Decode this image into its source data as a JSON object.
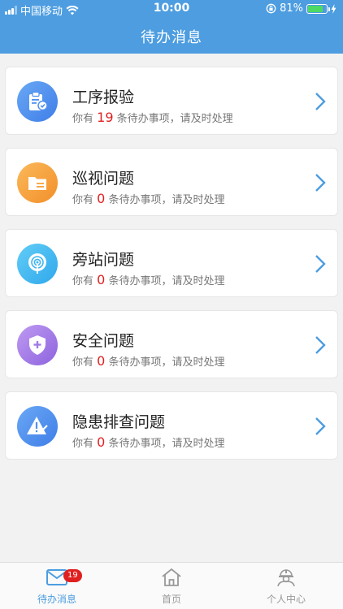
{
  "status_bar": {
    "carrier": "中国移动",
    "time": "10:00",
    "battery": "81%",
    "battery_level": 0.81
  },
  "header": {
    "title": "待办消息"
  },
  "items": [
    {
      "title": "工序报验",
      "prefix": "你有",
      "count": "19",
      "suffix": "条待办事项，请及时处理",
      "icon": "clipboard-icon",
      "color": "#4f8ff0"
    },
    {
      "title": "巡视问题",
      "prefix": "你有",
      "count": "0",
      "suffix": "条待办事项，请及时处理",
      "icon": "folder-icon",
      "color": "#f7a23c"
    },
    {
      "title": "旁站问题",
      "prefix": "你有",
      "count": "0",
      "suffix": "条待办事项，请及时处理",
      "icon": "broadcast-icon",
      "color": "#3fb6f0"
    },
    {
      "title": "安全问题",
      "prefix": "你有",
      "count": "0",
      "suffix": "条待办事项，请及时处理",
      "icon": "shield-icon",
      "color": "#a07be6"
    },
    {
      "title": "隐患排查问题",
      "prefix": "你有",
      "count": "0",
      "suffix": "条待办事项，请及时处理",
      "icon": "warning-icon",
      "color": "#4f8ff0"
    }
  ],
  "tabbar": {
    "tabs": [
      {
        "label": "待办消息",
        "icon": "mail-icon",
        "badge": "19"
      },
      {
        "label": "首页",
        "icon": "home-icon"
      },
      {
        "label": "个人中心",
        "icon": "worker-icon"
      }
    ]
  },
  "colors": {
    "accent": "#4d9de0",
    "count": "#e02020"
  }
}
